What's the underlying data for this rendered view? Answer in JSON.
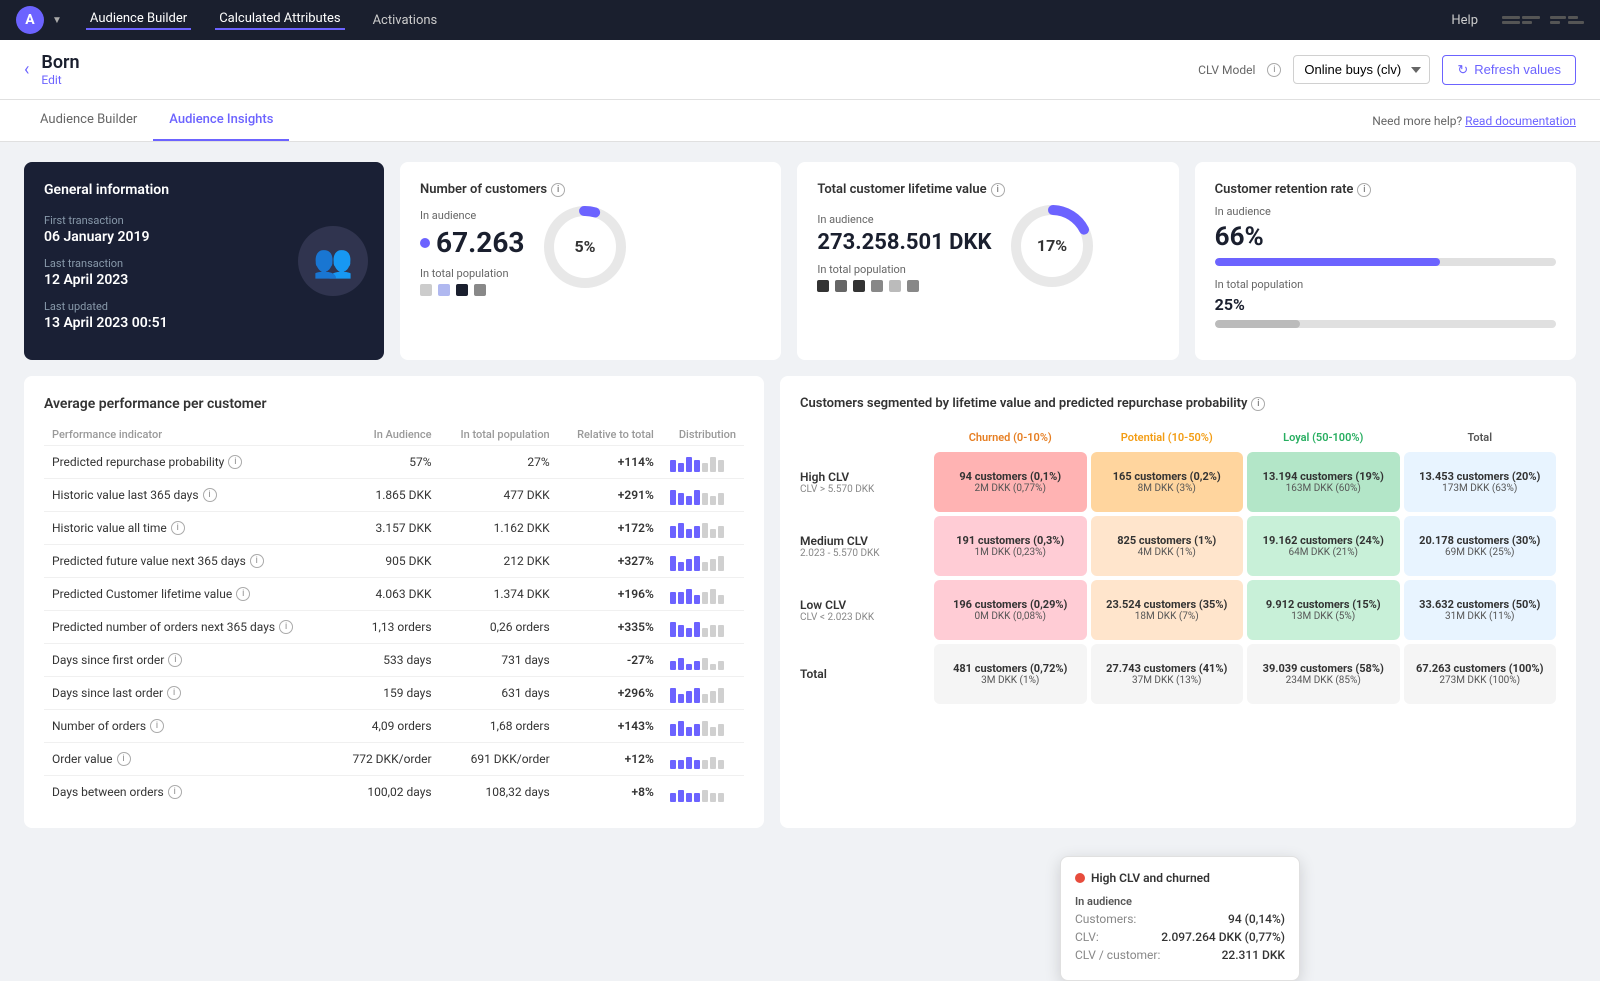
{
  "nav": {
    "logo": "A",
    "items": [
      {
        "label": "Audience Builder",
        "active": false
      },
      {
        "label": "Calculated Attributes",
        "active": true
      },
      {
        "label": "Activations",
        "active": false
      }
    ],
    "help": "Help"
  },
  "header": {
    "back": "←",
    "title": "Born",
    "edit": "Edit",
    "clv_label": "CLV Model",
    "clv_value": "Online buys (clv)",
    "refresh": "Refresh values"
  },
  "tabs": {
    "items": [
      {
        "label": "Audience Builder",
        "active": false
      },
      {
        "label": "Audience Insights",
        "active": true
      }
    ],
    "help_text": "Need more help?",
    "help_link": "Read documentation"
  },
  "general_info": {
    "title": "General information",
    "first_transaction_label": "First transaction",
    "first_transaction_value": "06 January 2019",
    "last_transaction_label": "Last transaction",
    "last_transaction_value": "12 April 2023",
    "last_updated_label": "Last updated",
    "last_updated_value": "13 April 2023 00:51"
  },
  "num_customers": {
    "title": "Number of customers",
    "in_audience_label": "In audience",
    "value": "67.263",
    "in_total_label": "In total population",
    "donut_pct": "5%",
    "donut_value": 5
  },
  "total_clv": {
    "title": "Total customer lifetime value",
    "in_audience_label": "In audience",
    "value": "273.258.501 DKK",
    "in_total_label": "In total population",
    "donut_pct": "17%",
    "donut_value": 17
  },
  "retention": {
    "title": "Customer retention rate",
    "in_audience_label": "In audience",
    "value": "66%",
    "fill_pct": 66,
    "in_total_label": "In total population",
    "total_value": "25%",
    "total_fill_pct": 25
  },
  "performance": {
    "title": "Average performance per customer",
    "columns": [
      "Performance indicator",
      "In Audience",
      "In total population",
      "Relative to total",
      "Distribution"
    ],
    "rows": [
      {
        "label": "Predicted repurchase probability",
        "in_audience": "57%",
        "in_total": "27%",
        "relative": "+114%",
        "relative_class": "positive",
        "bars": [
          4,
          3,
          5,
          4,
          3,
          5,
          4
        ]
      },
      {
        "label": "Historic value last 365 days",
        "in_audience": "1.865 DKK",
        "in_total": "477 DKK",
        "relative": "+291%",
        "relative_class": "positive",
        "bars": [
          5,
          4,
          3,
          5,
          4,
          3,
          4
        ]
      },
      {
        "label": "Historic value all time",
        "in_audience": "3.157 DKK",
        "in_total": "1.162 DKK",
        "relative": "+172%",
        "relative_class": "positive",
        "bars": [
          4,
          5,
          3,
          4,
          5,
          3,
          4
        ]
      },
      {
        "label": "Predicted future value next 365 days",
        "in_audience": "905 DKK",
        "in_total": "212 DKK",
        "relative": "+327%",
        "relative_class": "positive",
        "bars": [
          5,
          3,
          4,
          5,
          3,
          4,
          5
        ]
      },
      {
        "label": "Predicted Customer lifetime value",
        "in_audience": "4.063 DKK",
        "in_total": "1.374 DKK",
        "relative": "+196%",
        "relative_class": "positive",
        "bars": [
          4,
          4,
          5,
          3,
          4,
          5,
          3
        ]
      },
      {
        "label": "Predicted number of orders next 365 days",
        "in_audience": "1,13 orders",
        "in_total": "0,26 orders",
        "relative": "+335%",
        "relative_class": "positive",
        "bars": [
          5,
          4,
          3,
          5,
          3,
          4,
          4
        ]
      },
      {
        "label": "Days since first order",
        "in_audience": "533 days",
        "in_total": "731 days",
        "relative": "-27%",
        "relative_class": "negative",
        "bars": [
          3,
          4,
          2,
          3,
          4,
          2,
          3
        ]
      },
      {
        "label": "Days since last order",
        "in_audience": "159 days",
        "in_total": "631 days",
        "relative": "+296%",
        "relative_class": "positive",
        "bars": [
          5,
          3,
          4,
          5,
          3,
          4,
          5
        ]
      },
      {
        "label": "Number of orders",
        "in_audience": "4,09 orders",
        "in_total": "1,68 orders",
        "relative": "+143%",
        "relative_class": "positive",
        "bars": [
          4,
          5,
          3,
          4,
          5,
          3,
          4
        ]
      },
      {
        "label": "Order value",
        "in_audience": "772 DKK/order",
        "in_total": "691 DKK/order",
        "relative": "+12%",
        "relative_class": "positive",
        "bars": [
          3,
          3,
          4,
          3,
          3,
          4,
          3
        ]
      },
      {
        "label": "Days between orders",
        "in_audience": "100,02 days",
        "in_total": "108,32 days",
        "relative": "+8%",
        "relative_class": "positive",
        "bars": [
          3,
          4,
          3,
          3,
          4,
          3,
          3
        ]
      }
    ]
  },
  "segmentation": {
    "title": "Customers segmented by lifetime value and predicted repurchase probability",
    "col_headers": [
      "",
      "Churned (0-10%)",
      "Potential (10-50%)",
      "Loyal (50-100%)",
      "Total"
    ],
    "rows": [
      {
        "label": "High CLV",
        "sub": "CLV > 5.570 DKK",
        "cells": [
          {
            "text": "94 customers (0,1%)",
            "sub": "2M DKK (0,77%)",
            "class": "seg-cell-red"
          },
          {
            "text": "165 customers (0,2%)",
            "sub": "8M DKK (3%)",
            "class": "seg-cell-orange"
          },
          {
            "text": "13.194 customers (19%)",
            "sub": "163M DKK (60%)",
            "class": "seg-cell-green-light"
          },
          {
            "text": "13.453 customers (20%)",
            "sub": "173M DKK (63%)",
            "class": "seg-cell-total"
          }
        ]
      },
      {
        "label": "Medium CLV",
        "sub": "2.023 - 5.570 DKK",
        "cells": [
          {
            "text": "191 customers (0,3%)",
            "sub": "1M DKK (0,23%)",
            "class": "seg-cell-pink"
          },
          {
            "text": "825 customers (1%)",
            "sub": "4M DKK (1%)",
            "class": "seg-cell-peach"
          },
          {
            "text": "19.162 customers (24%)",
            "sub": "64M DKK (21%)",
            "class": "seg-cell-green"
          },
          {
            "text": "20.178 customers (30%)",
            "sub": "69M DKK (25%)",
            "class": "seg-cell-total"
          }
        ]
      },
      {
        "label": "Low CLV",
        "sub": "CLV < 2.023 DKK",
        "cells": [
          {
            "text": "196 customers (0,29%)",
            "sub": "0M DKK (0,08%)",
            "class": "seg-cell-pink"
          },
          {
            "text": "23.524 customers (35%)",
            "sub": "18M DKK (7%)",
            "class": "seg-cell-peach"
          },
          {
            "text": "9.912 customers (15%)",
            "sub": "13M DKK (5%)",
            "class": "seg-cell-green"
          },
          {
            "text": "33.632 customers (50%)",
            "sub": "31M DKK (11%)",
            "class": "seg-cell-total"
          }
        ]
      },
      {
        "label": "Total",
        "sub": "",
        "cells": [
          {
            "text": "481 customers (0,72%)",
            "sub": "3M DKK (1%)",
            "class": "seg-cell-footer"
          },
          {
            "text": "27.743 customers (41%)",
            "sub": "37M DKK (13%)",
            "class": "seg-cell-footer"
          },
          {
            "text": "39.039 customers (58%)",
            "sub": "234M DKK (85%)",
            "class": "seg-cell-footer"
          },
          {
            "text": "67.263 customers (100%)",
            "sub": "273M DKK (100%)",
            "class": "seg-cell-footer"
          }
        ]
      }
    ]
  },
  "tooltip": {
    "title": "High CLV and churned",
    "in_audience": "In audience",
    "customers_label": "Customers:",
    "customers_value": "94 (0,14%)",
    "clv_label": "CLV:",
    "clv_value": "2.097.264 DKK (0,77%)",
    "clv_per_customer_label": "CLV / customer:",
    "clv_per_customer_value": "22.311 DKK"
  }
}
